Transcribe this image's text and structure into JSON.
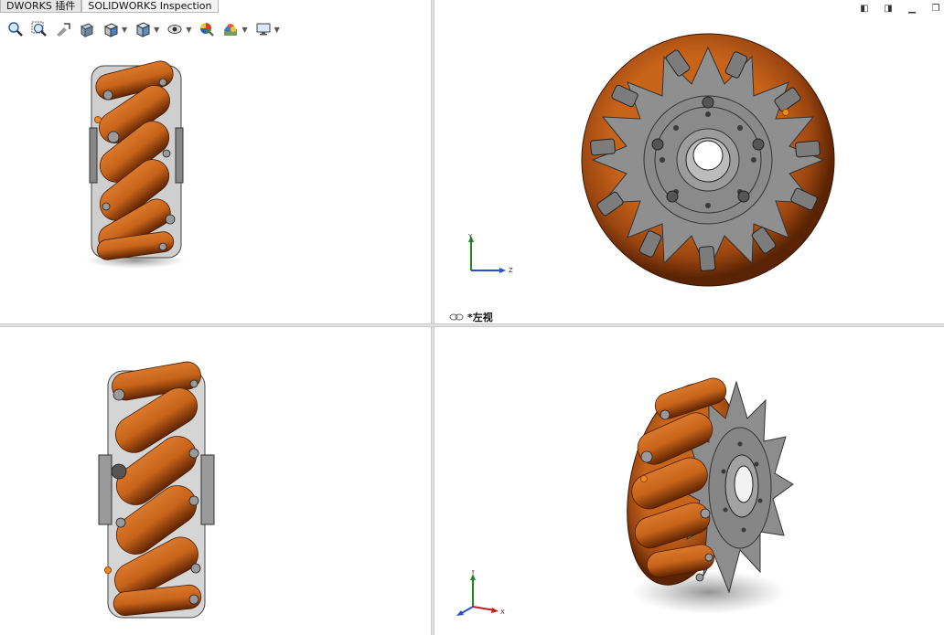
{
  "tabs": [
    {
      "label": "DWORKS 插件"
    },
    {
      "label": "SOLIDWORKS Inspection"
    }
  ],
  "toolbar": {
    "icons": [
      "zoom-to-fit-icon",
      "zoom-to-area-icon",
      "previous-view-icon",
      "section-view-icon",
      "view-orientation-icon",
      "display-style-icon",
      "hide-show-items-icon",
      "edit-appearance-icon",
      "apply-scene-icon",
      "view-settings-icon"
    ]
  },
  "viewports": {
    "top_right": {
      "label": "*左视",
      "axes": {
        "y": "Y",
        "z": "Z"
      }
    },
    "bottom_right": {
      "axes": {
        "y": "Y",
        "x": "X"
      }
    }
  },
  "colors": {
    "roller": "#c8641a",
    "roller_dark": "#7a3308",
    "hub": "#8c8c8c",
    "hub_dark": "#555555",
    "background": "#ffffff"
  }
}
